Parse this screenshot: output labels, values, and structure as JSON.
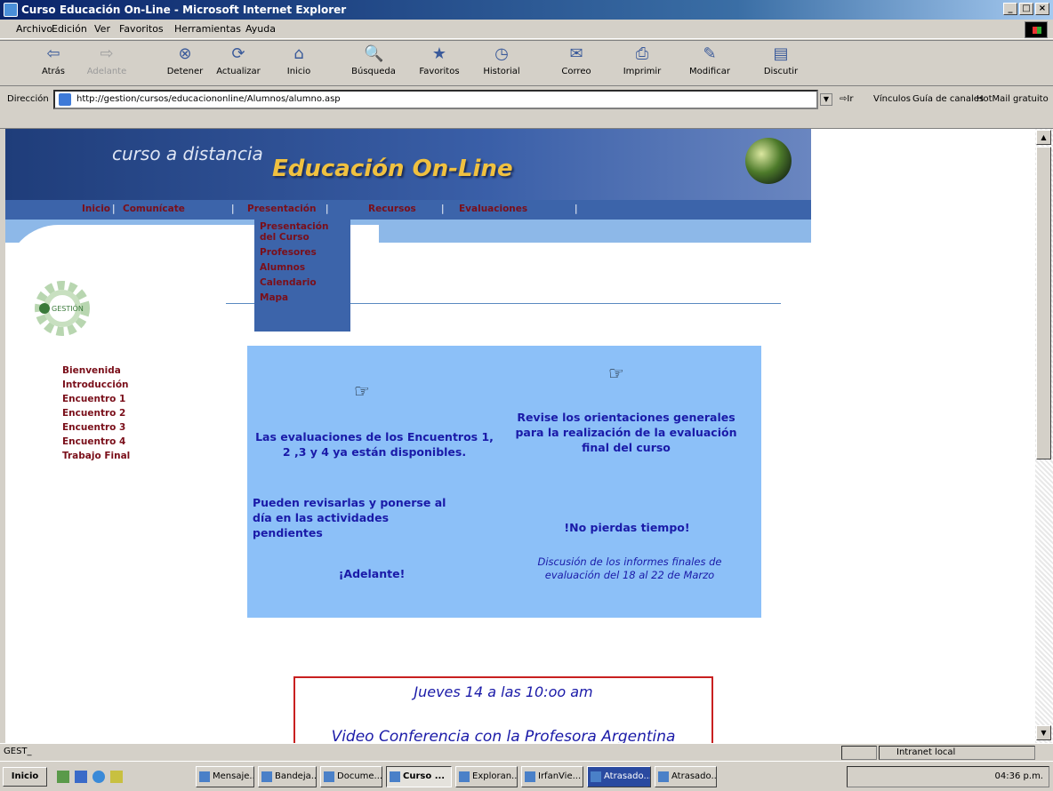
{
  "window": {
    "title": "Curso Educación On-Line - Microsoft Internet Explorer"
  },
  "menu": [
    "Archivo",
    "Edición",
    "Ver",
    "Favoritos",
    "Herramientas",
    "Ayuda"
  ],
  "toolbar": [
    {
      "label": "Atrás",
      "icon": "back-arrow-icon",
      "enabled": true
    },
    {
      "label": "Adelante",
      "icon": "forward-arrow-icon",
      "enabled": false
    },
    {
      "label": "Detener",
      "icon": "stop-icon",
      "enabled": true
    },
    {
      "label": "Actualizar",
      "icon": "refresh-icon",
      "enabled": true
    },
    {
      "label": "Inicio",
      "icon": "home-icon",
      "enabled": true
    },
    {
      "label": "Búsqueda",
      "icon": "search-icon",
      "enabled": true
    },
    {
      "label": "Favoritos",
      "icon": "favorites-icon",
      "enabled": true
    },
    {
      "label": "Historial",
      "icon": "history-icon",
      "enabled": true
    },
    {
      "label": "Correo",
      "icon": "mail-icon",
      "enabled": true
    },
    {
      "label": "Imprimir",
      "icon": "print-icon",
      "enabled": true
    },
    {
      "label": "Modificar",
      "icon": "edit-icon",
      "enabled": true
    },
    {
      "label": "Discutir",
      "icon": "discuss-icon",
      "enabled": true
    }
  ],
  "address": {
    "label": "Dirección",
    "url": "http://gestion/cursos/educaciononline/Alumnos/alumno.asp",
    "go_label": "Ir",
    "links_label": "Vínculos",
    "link1": "Guía de canales",
    "link2": "HotMail gratuito"
  },
  "site": {
    "subtitle": "curso a distancia",
    "title": "Educación On-Line",
    "nav": [
      "Inicio",
      "Comunícate",
      "Presentación",
      "Recursos",
      "Evaluaciones"
    ],
    "dropdown": [
      "Presentación del Curso",
      "Profesores",
      "Alumnos",
      "Calendario",
      "Mapa"
    ],
    "logo_text": "GESTIÓN",
    "left_nav": [
      "Bienvenida",
      "Introducción",
      "Encuentro 1",
      "Encuentro 2",
      "Encuentro 3",
      "Encuentro 4",
      "Trabajo Final"
    ],
    "box": {
      "left_msg1": "Las evaluaciones de los Encuentros 1, 2 ,3 y 4 ya están disponibles.",
      "left_msg2": "Pueden revisarlas y ponerse al día en las actividades pendientes",
      "left_msg3": "¡Adelante!",
      "right_msg1": "Revise los orientaciones generales para la realización de la evaluación final del curso",
      "right_msg2": "!No pierdas tiempo!",
      "right_msg3": "Discusión de los informes finales de evaluación del 18 al 22 de Marzo"
    },
    "event": {
      "line1": "Jueves 14 a las 10:oo am",
      "line2": "Video Conferencia con la Profesora Argentina"
    }
  },
  "status": {
    "text": "GEST_",
    "zone": "Intranet local"
  },
  "taskbar": {
    "start": "Inicio",
    "tasks": [
      "Mensaje...",
      "Bandeja...",
      "Docume...",
      "Curso ...",
      "Exploran...",
      "IrfanVie...",
      "Atrasado...",
      "Atrasado..."
    ],
    "clock": "04:36 p.m."
  }
}
